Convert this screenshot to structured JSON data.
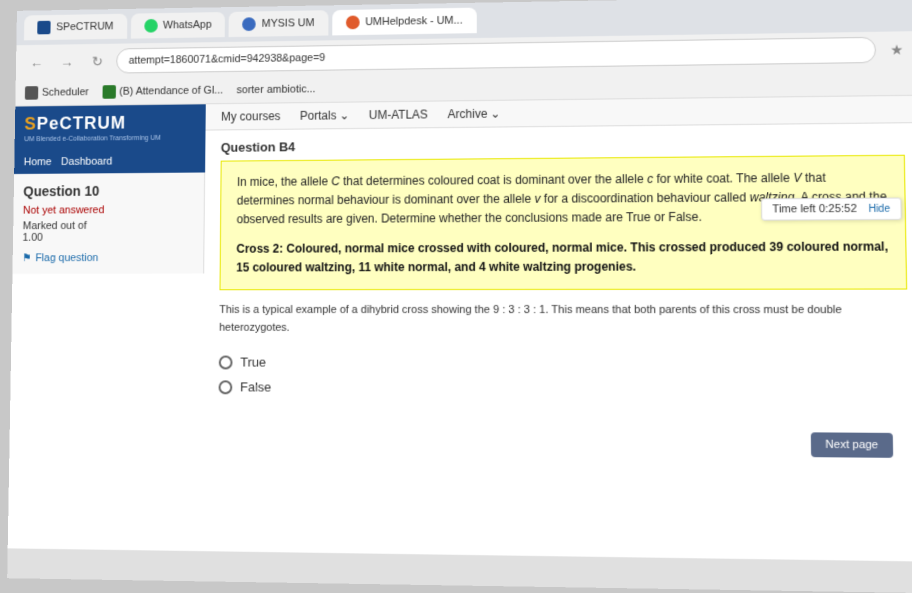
{
  "browser": {
    "address_url": "attempt=1860071&cmid=942938&page=9",
    "tabs": [
      {
        "id": "spectrum",
        "label": "SPeCTRUM",
        "icon": "spectrum",
        "active": false
      },
      {
        "id": "whatsapp",
        "label": "WhatsApp",
        "icon": "whatsapp",
        "active": false
      },
      {
        "id": "mysis",
        "label": "MYSIS UM",
        "icon": "mysis",
        "active": false
      },
      {
        "id": "umhelpdesk",
        "label": "UMHelpdesk - UM...",
        "icon": "umhelpdesk",
        "active": true
      }
    ]
  },
  "lms_nav": {
    "home": "Home",
    "dashboard": "Dashboard",
    "my_courses": "My courses",
    "portals": "Portals",
    "um_atlas": "UM-ATLAS",
    "archive": "Archive"
  },
  "bookmarks": {
    "scheduler": "Scheduler",
    "attendance": "(B) Attendance of Gl...",
    "sorter": "sorter ambiotic..."
  },
  "question_info": {
    "number": "Question 10",
    "status": "Not yet answered",
    "mark_label": "Marked out of",
    "mark_value": "1.00",
    "flag_label": "Flag question"
  },
  "question_b4": {
    "header": "Question B4",
    "body_text": "In mice, the allele C that determines coloured coat is dominant over the allele c for white coat. The allele V that determines normal behaviour is dominant over the allele v for a discoordination behaviour called waltzing. A cross and the observed results are given. Determine whether the conclusions made are True or False.",
    "cross_text": "Cross 2: Coloured, normal mice crossed with coloured, normal mice. This crossed produced  39 coloured normal, 15 coloured waltzing, 11 white normal, and 4 white waltzing progenies."
  },
  "explanation": {
    "text": "This is a typical example of a dihybrid cross showing the 9 : 3 : 3 : 1. This means that both parents of this cross must be double heterozygotes."
  },
  "answers": {
    "options": [
      {
        "id": "true",
        "label": "True"
      },
      {
        "id": "false",
        "label": "False"
      }
    ]
  },
  "timer": {
    "label": "Time left 0:25:52",
    "hide_btn": "Hide"
  },
  "next_page_btn": "Next page",
  "logo": {
    "text": "SPeCTRUM",
    "subtitle": "UM Blended e-Collaboration Transforming UM"
  }
}
